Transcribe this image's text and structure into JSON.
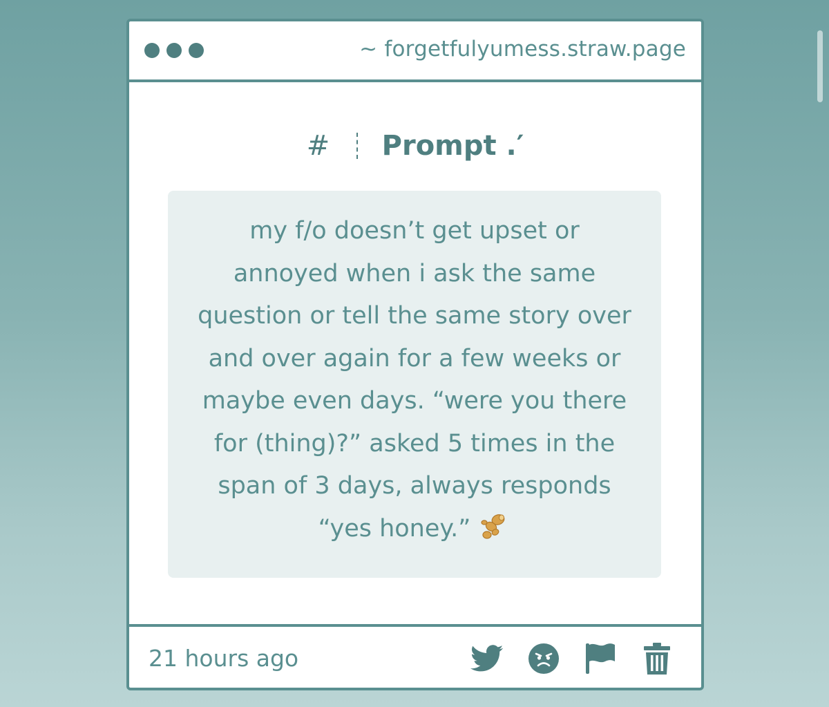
{
  "window": {
    "url": "~ forgetfulyumess.straw.page"
  },
  "header": {
    "hash": "#",
    "title": "Prompt .′"
  },
  "prompt": {
    "lines": [
      "my f/o doesn’t get upset or",
      "annoyed when i ask the same",
      "question or tell the same story over",
      "and over again for a few weeks or",
      "maybe even days. “were you there",
      "for (thing)?” asked 5 times in the",
      "span of 3 days, always responds",
      "“yes honey.”"
    ],
    "emoji": "ginger-root-emoji"
  },
  "footer": {
    "timestamp": "21 hours ago",
    "actions": [
      "twitter-icon",
      "angry-face-icon",
      "flag-icon",
      "trash-icon"
    ]
  },
  "colors": {
    "accent": "#5a8f90",
    "dark_accent": "#4f7f80",
    "box_bg": "#e8f0f0",
    "window_bg": "#ffffff"
  }
}
